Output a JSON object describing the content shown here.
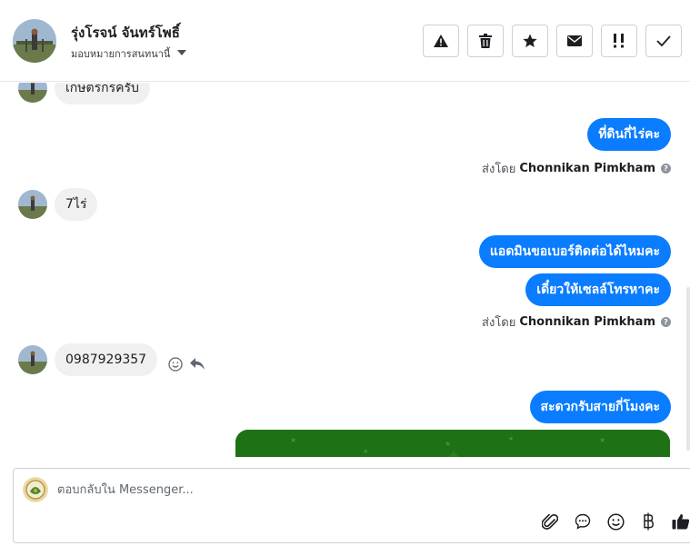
{
  "header": {
    "contact_name": "รุ่งโรจน์ จันทร์โพธิ์",
    "assign_label": "มอบหมายการสนทนานี้",
    "actions": [
      {
        "name": "spam-button",
        "icon": "warning-icon"
      },
      {
        "name": "delete-button",
        "icon": "trash-icon"
      },
      {
        "name": "star-button",
        "icon": "star-icon"
      },
      {
        "name": "mark-unread-button",
        "icon": "envelope-icon"
      },
      {
        "name": "follow-up-button",
        "icon": "exclamation-icon"
      },
      {
        "name": "mark-done-button",
        "icon": "check-icon"
      }
    ]
  },
  "messages": [
    {
      "direction": "in",
      "text": "เกษตรกรครับ"
    },
    {
      "direction": "out",
      "text": "ที่ดินกี่ไร่คะ"
    },
    {
      "sent_by_prefix": "ส่งโดย",
      "sent_by_name": "Chonnikan Pimkham"
    },
    {
      "direction": "in",
      "text": "7ไร่"
    },
    {
      "direction": "out",
      "text": "แอดมินขอเบอร์ติดต่อได้ไหมคะ"
    },
    {
      "direction": "out",
      "text": "เดี๋ยวให้เซลล์โทรหาคะ"
    },
    {
      "sent_by_prefix": "ส่งโดย",
      "sent_by_name": "Chonnikan Pimkham"
    },
    {
      "direction": "in",
      "text": "0987929357"
    },
    {
      "direction": "out",
      "text": "สะดวกรับสายกี่โมงคะ"
    }
  ],
  "composer": {
    "placeholder": "ตอบกลับใน Messenger...",
    "tools": [
      "paperclip-icon",
      "chat-bubble-icon",
      "smiley-icon",
      "baht-icon",
      "thumbs-up-icon"
    ]
  },
  "colors": {
    "accent": "#0a7cff",
    "incoming_bubble": "#f0f0f0",
    "image_green": "#1a6b12"
  }
}
